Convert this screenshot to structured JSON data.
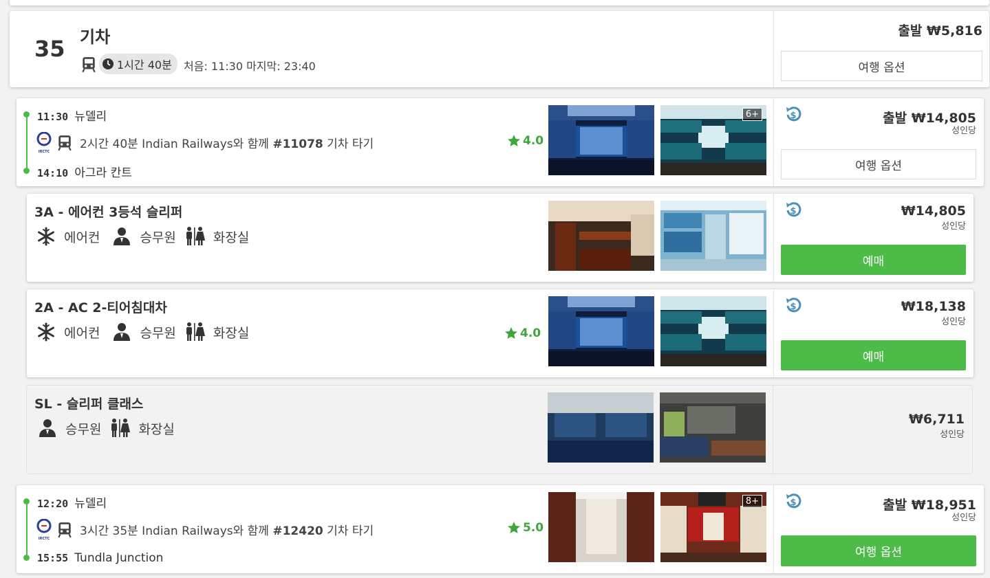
{
  "summary": {
    "count": "35",
    "mode": "기차",
    "duration": "1시간 40분",
    "schedule": "처음: 11:30 마지막: 23:40",
    "price": "출발 ₩5,816",
    "options_button": "여행 옵션"
  },
  "trip1": {
    "dep_time": "11:30",
    "dep_station": "뉴델리",
    "arr_time": "14:10",
    "arr_station": "아그라 칸트",
    "duration_text": "2시간 40분 Indian Railways와 함께",
    "train_number": "#11078",
    "suffix": "기차 타기",
    "rating": "4.0",
    "photo_badge": "6+",
    "price": "출발 ₩14,805",
    "per_person": "성인당",
    "options_button": "여행 옵션",
    "logo_text": "IRCTC"
  },
  "classes": [
    {
      "title": "3A - 에어컨 3등석 슬리퍼",
      "amenities": [
        "에어컨",
        "승무원",
        "화장실"
      ],
      "price": "₩14,805",
      "per_person": "성인당",
      "book": "예매",
      "rating": ""
    },
    {
      "title": "2A - AC 2-티어침대차",
      "amenities": [
        "에어컨",
        "승무원",
        "화장실"
      ],
      "price": "₩18,138",
      "per_person": "성인당",
      "book": "예매",
      "rating": "4.0"
    },
    {
      "title": "SL - 슬리퍼 클래스",
      "amenities": [
        "승무원",
        "화장실"
      ],
      "price": "₩6,711",
      "per_person": "성인당"
    }
  ],
  "trip2": {
    "dep_time": "12:20",
    "dep_station": "뉴델리",
    "arr_time": "15:55",
    "arr_station": "Tundla Junction",
    "duration_text": "3시간 35분 Indian Railways와 함께",
    "train_number": "#12420",
    "suffix": "기차 타기",
    "rating": "5.0",
    "photo_badge": "8+",
    "price": "출발 ₩18,951",
    "per_person": "성인당",
    "options_button": "여행 옵션",
    "logo_text": "IRCTC"
  },
  "icons": {
    "train": "train-icon",
    "clock": "clock-icon",
    "star": "star-icon",
    "refund": "refund-icon",
    "snowflake": "snowflake-icon",
    "attendant": "attendant-icon",
    "restroom": "restroom-icon"
  },
  "colors": {
    "accent_green": "#4cbb47",
    "rating_green": "#3fa63c",
    "refund_blue": "#4a90b8"
  }
}
